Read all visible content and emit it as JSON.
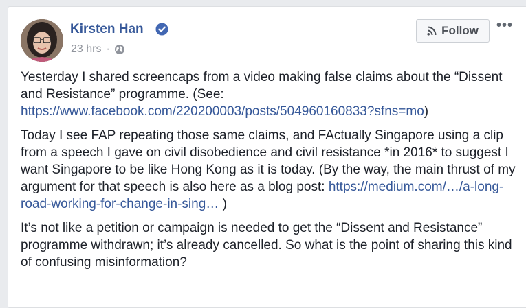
{
  "post": {
    "author": "Kirsten Han",
    "timestamp": "23 hrs",
    "separator": "·",
    "audience_icon": "globe-icon",
    "verified_icon": "verified-badge-icon",
    "follow_label": "Follow",
    "follow_icon": "rss-feed-icon",
    "more_label": "•••",
    "paragraphs": {
      "p1": {
        "text1": "Yesterday I shared screencaps from a video making false claims about the “Dissent and Resistance” programme. (See: ",
        "link": "https://www.facebook.com/220200003/posts/504960160833?sfns=mo",
        "text2": ")"
      },
      "p2": {
        "text1": "Today I see FAP repeating those same claims, and FActually Singapore using a clip from a speech I gave on civil disobedience and civil resistance *in 2016* to suggest I want Singapore to be like Hong Kong as it is today. (By the way, the main thrust of my argument for that speech is also here as a blog post: ",
        "link": "https://medium.com/…/a-long-road-working-for-change-in-sing…",
        "text2": " )"
      },
      "p3": {
        "text": "It’s not like a petition or campaign is needed to get the “Dissent and Resistance” programme withdrawn; it’s already cancelled. So what is the point of sharing this kind of confusing misinformation?"
      }
    }
  },
  "colors": {
    "link": "#365899",
    "text": "#1d2129",
    "meta": "#90949c",
    "background": "#e9ebee",
    "verified": "#4267b2"
  }
}
